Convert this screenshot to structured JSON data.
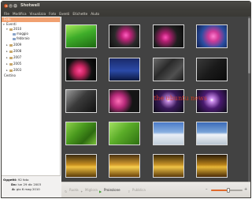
{
  "window": {
    "title": "Shotwell"
  },
  "menu": [
    "File",
    "Modifica",
    "Visualizza",
    "Foto",
    "Eventi",
    "Etichette",
    "Aiuto"
  ],
  "sidebar": {
    "items": [
      {
        "label": "Foto",
        "level": 0,
        "selected": true
      },
      {
        "label": "Eventi",
        "level": 0,
        "expanded": true
      },
      {
        "label": "2010",
        "level": 1,
        "expanded": true
      },
      {
        "label": "maggio",
        "level": 2
      },
      {
        "label": "febbraio",
        "level": 2
      },
      {
        "label": "2009",
        "level": 1
      },
      {
        "label": "2008",
        "level": 1
      },
      {
        "label": "2007",
        "level": 1
      },
      {
        "label": "2005",
        "level": 1
      },
      {
        "label": "2003",
        "level": 1
      },
      {
        "label": "Cestino",
        "level": 0
      }
    ]
  },
  "info": {
    "objects_label": "Oggetti:",
    "objects_value": "92 foto",
    "from_label": "Da:",
    "from_value": "lun 29 dic 2003",
    "to_label": "A:",
    "to_value": "gio 6 mag 2010"
  },
  "watermark": "the ubuntu news",
  "toolbar": {
    "rotate_label": "Ruota",
    "enhance_label": "Migliora",
    "slideshow_label": "Proiezione",
    "publish_label": "Pubblica"
  },
  "zoom": {
    "level": 0.55
  },
  "colors": {
    "accent": "#e06a2c",
    "selection": "#f0a070",
    "content_bg": "#424242"
  }
}
